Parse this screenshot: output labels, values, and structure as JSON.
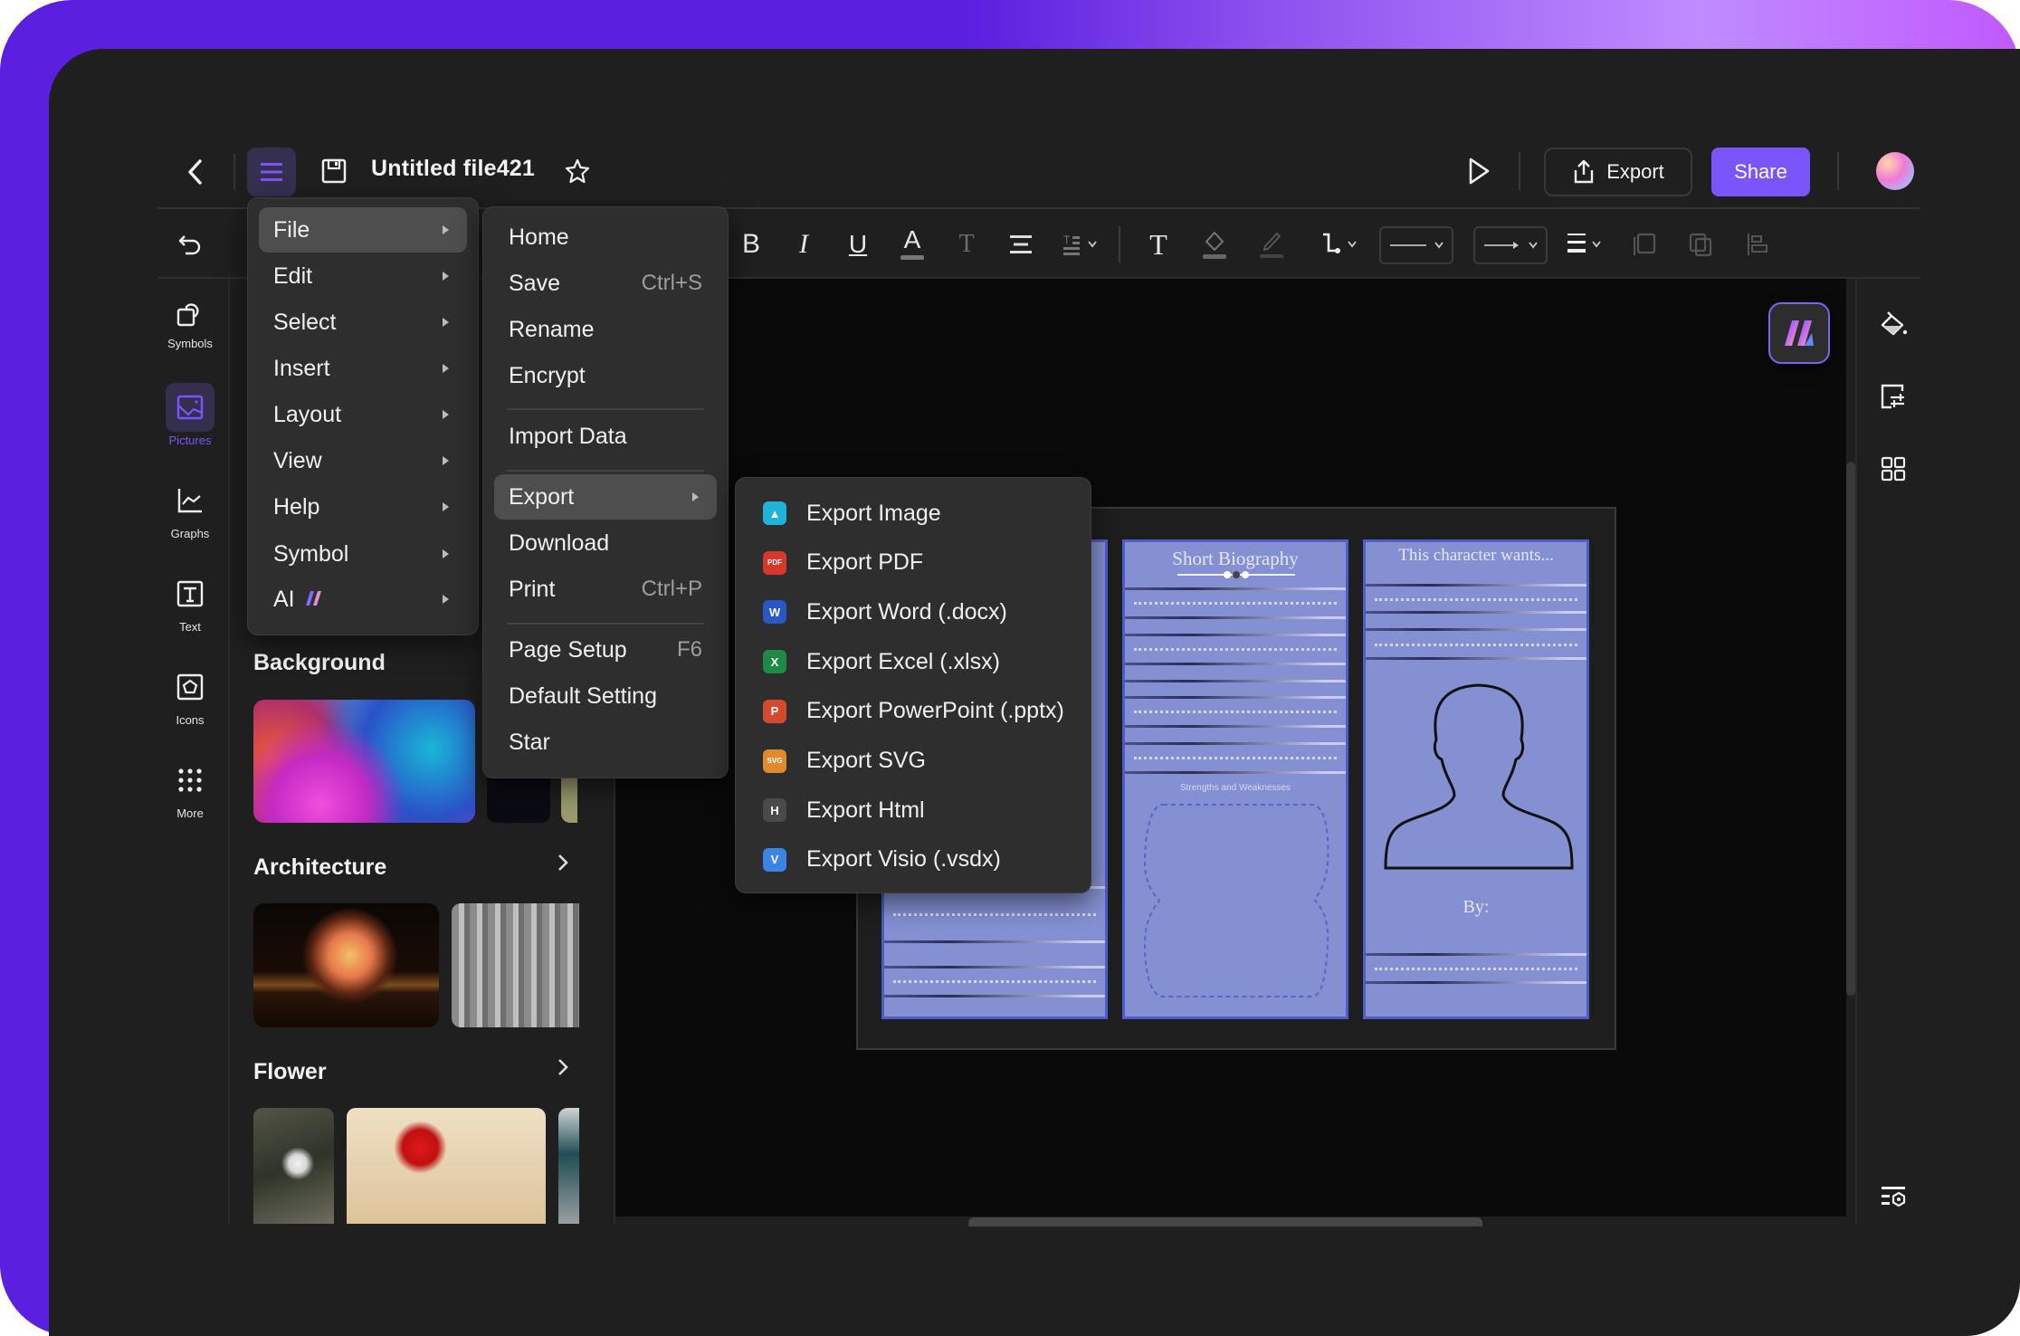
{
  "app": {
    "title": "Untitled file421",
    "header_buttons": {
      "export_label": "Export",
      "share_label": "Share"
    }
  },
  "colors": {
    "accent": "#7a55fb",
    "frame_gradient_start": "#5b1fdf",
    "frame_gradient_end": "#c059ff",
    "window_bg": "#1f1f1f",
    "canvas_bg": "#0a0a0a",
    "doc_panel": "#8590d2"
  },
  "left_rail": {
    "items": [
      {
        "label": "Symbols",
        "icon": "symbols-icon",
        "active": false
      },
      {
        "label": "Pictures",
        "icon": "pictures-icon",
        "active": true
      },
      {
        "label": "Graphs",
        "icon": "graphs-icon",
        "active": false
      },
      {
        "label": "Text",
        "icon": "text-icon",
        "active": false
      },
      {
        "label": "Icons",
        "icon": "icons-icon",
        "active": false
      },
      {
        "label": "More",
        "icon": "more-icon",
        "active": false
      }
    ]
  },
  "library": {
    "sections": [
      {
        "title": "Background",
        "has_more": false
      },
      {
        "title": "Architecture",
        "has_more": true
      },
      {
        "title": "Flower",
        "has_more": true
      }
    ]
  },
  "main_menu": {
    "items": [
      {
        "label": "File",
        "highlighted": true
      },
      {
        "label": "Edit"
      },
      {
        "label": "Select"
      },
      {
        "label": "Insert"
      },
      {
        "label": "Layout"
      },
      {
        "label": "View"
      },
      {
        "label": "Help"
      },
      {
        "label": "Symbol"
      },
      {
        "label": "AI"
      }
    ]
  },
  "file_menu": {
    "items": [
      {
        "label": "Home"
      },
      {
        "label": "Save",
        "shortcut": "Ctrl+S"
      },
      {
        "label": "Rename"
      },
      {
        "label": "Encrypt"
      },
      {
        "label": "Import Data"
      },
      {
        "label": "Export",
        "highlighted": true,
        "submenu": true
      },
      {
        "label": "Download"
      },
      {
        "label": "Print",
        "shortcut": "Ctrl+P"
      },
      {
        "label": "Page Setup",
        "shortcut": "F6"
      },
      {
        "label": "Default Setting"
      },
      {
        "label": "Star"
      }
    ]
  },
  "export_menu": {
    "items": [
      {
        "label": "Export Image",
        "icon": "image-icon",
        "glyph": "▲",
        "color": "#1fb3d9"
      },
      {
        "label": "Export PDF",
        "icon": "pdf-icon",
        "glyph": "PDF",
        "color": "#d6382a"
      },
      {
        "label": "Export Word (.docx)",
        "icon": "word-icon",
        "glyph": "W",
        "color": "#2a57c7"
      },
      {
        "label": "Export Excel (.xlsx)",
        "icon": "excel-icon",
        "glyph": "X",
        "color": "#1e8a46"
      },
      {
        "label": "Export PowerPoint (.pptx)",
        "icon": "powerpoint-icon",
        "glyph": "P",
        "color": "#d44a2e"
      },
      {
        "label": "Export SVG",
        "icon": "svg-icon",
        "glyph": "SVG",
        "color": "#e08a2e"
      },
      {
        "label": "Export Html",
        "icon": "html-icon",
        "glyph": "H",
        "color": "#4a4a4a"
      },
      {
        "label": "Export Visio (.vsdx)",
        "icon": "visio-icon",
        "glyph": "V",
        "color": "#3b84e6"
      }
    ]
  },
  "document": {
    "panel2_title": "Short Biography",
    "panel2_subtitle": "Strengths and Weaknesses",
    "panel3_title": "This character wants...",
    "panel3_by": "By:"
  }
}
